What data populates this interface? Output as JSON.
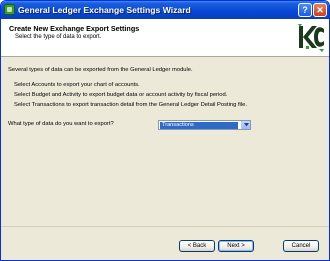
{
  "window": {
    "title": "General Ledger Exchange Settings Wizard",
    "help_label": "?",
    "close_label": "✕"
  },
  "header": {
    "title": "Create New Exchange Export Settings",
    "subtitle": "Select the type of data to export."
  },
  "content": {
    "intro": "Several types of data can be exported from the General Ledger module.",
    "lines": [
      "Select Accounts to export your chart of accounts.",
      "Select Budget and Activity to export budget data or account activity by fiscal period.",
      "Select Transactions to export transaction detail from the General Ledger Detail Posting file."
    ],
    "question": "What type of data do you want to export?",
    "data_type": {
      "selected": "Transactions"
    }
  },
  "buttons": {
    "back": "< Back",
    "next": "Next >",
    "cancel": "Cancel"
  },
  "colors": {
    "titlebar": "#0a4bd6",
    "selection": "#316ac5",
    "dialog_bg": "#ece9d8"
  }
}
